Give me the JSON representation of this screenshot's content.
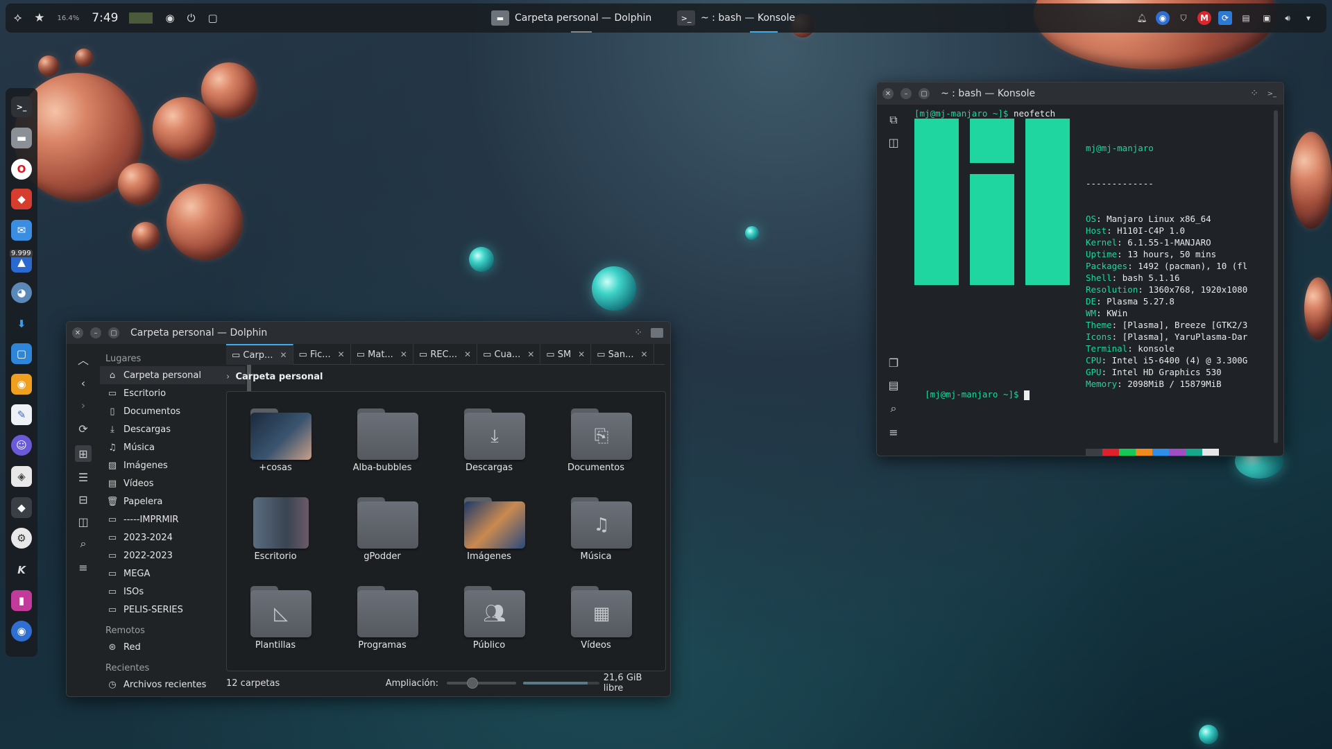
{
  "taskbar": {
    "percent": "16.4%",
    "clock": "7:49",
    "tasks": [
      {
        "title": "Carpeta personal — Dolphin"
      },
      {
        "title": "~ : bash — Konsole"
      }
    ]
  },
  "dock": {
    "badge": "9.999"
  },
  "dolphin": {
    "window_title": "Carpeta personal — Dolphin",
    "places_header": "Lugares",
    "places": [
      "Carpeta personal",
      "Escritorio",
      "Documentos",
      "Descargas",
      "Música",
      "Imágenes",
      "Vídeos",
      "Papelera",
      "-----IMPRMIR",
      "2023-2024",
      "2022-2023",
      "MEGA",
      "ISOs",
      "PELIS-SERIES"
    ],
    "remote_header": "Remotos",
    "remote": [
      "Red"
    ],
    "recent_header": "Recientes",
    "recent": [
      "Archivos recientes"
    ],
    "tabs": [
      "Carp...",
      "Fic...",
      "Mat...",
      "REC...",
      "Cua...",
      "SM",
      "San..."
    ],
    "breadcrumb": "Carpeta personal",
    "items": [
      "+cosas",
      "Alba-bubbles",
      "Descargas",
      "Documentos",
      "Escritorio",
      "gPodder",
      "Imágenes",
      "Música",
      "Plantillas",
      "Programas",
      "Público",
      "Vídeos"
    ],
    "status_count": "12 carpetas",
    "zoom_label": "Ampliación:",
    "zoom_level": 0.35,
    "free_space": "21,6 GiB libre",
    "space_used_fraction": 0.85
  },
  "konsole": {
    "window_title": "~ : bash — Konsole",
    "prompt": "[mj@mj-manjaro ~]$",
    "command": "neofetch",
    "user_host": "mj@mj-manjaro",
    "separator": "-------------",
    "info": [
      {
        "k": "OS",
        "v": "Manjaro Linux x86_64"
      },
      {
        "k": "Host",
        "v": "H110I-C4P 1.0"
      },
      {
        "k": "Kernel",
        "v": "6.1.55-1-MANJARO"
      },
      {
        "k": "Uptime",
        "v": "13 hours, 50 mins"
      },
      {
        "k": "Packages",
        "v": "1492 (pacman), 10 (fl"
      },
      {
        "k": "Shell",
        "v": "bash 5.1.16"
      },
      {
        "k": "Resolution",
        "v": "1360x768, 1920x1080"
      },
      {
        "k": "DE",
        "v": "Plasma 5.27.8"
      },
      {
        "k": "WM",
        "v": "KWin"
      },
      {
        "k": "Theme",
        "v": "[Plasma], Breeze [GTK2/3"
      },
      {
        "k": "Icons",
        "v": "[Plasma], YaruPlasma-Dar"
      },
      {
        "k": "Terminal",
        "v": "konsole"
      },
      {
        "k": "CPU",
        "v": "Intel i5-6400 (4) @ 3.300G"
      },
      {
        "k": "GPU",
        "v": "Intel HD Graphics 530"
      },
      {
        "k": "Memory",
        "v": "2098MiB / 15879MiB"
      }
    ],
    "swatches_top": [
      "#3b3f44",
      "#e0212b",
      "#14c956",
      "#f08a1c",
      "#2f8fe8",
      "#a04ec2",
      "#16a88a",
      "#e6e6e6"
    ],
    "swatches_bottom": [
      "#7f8388",
      "#f04a4a",
      "#33e07a",
      "#f6b845",
      "#58aef5",
      "#c07ae0",
      "#1fd6a0",
      "#ffffff"
    ],
    "logo_color": "#1fd6a0"
  }
}
